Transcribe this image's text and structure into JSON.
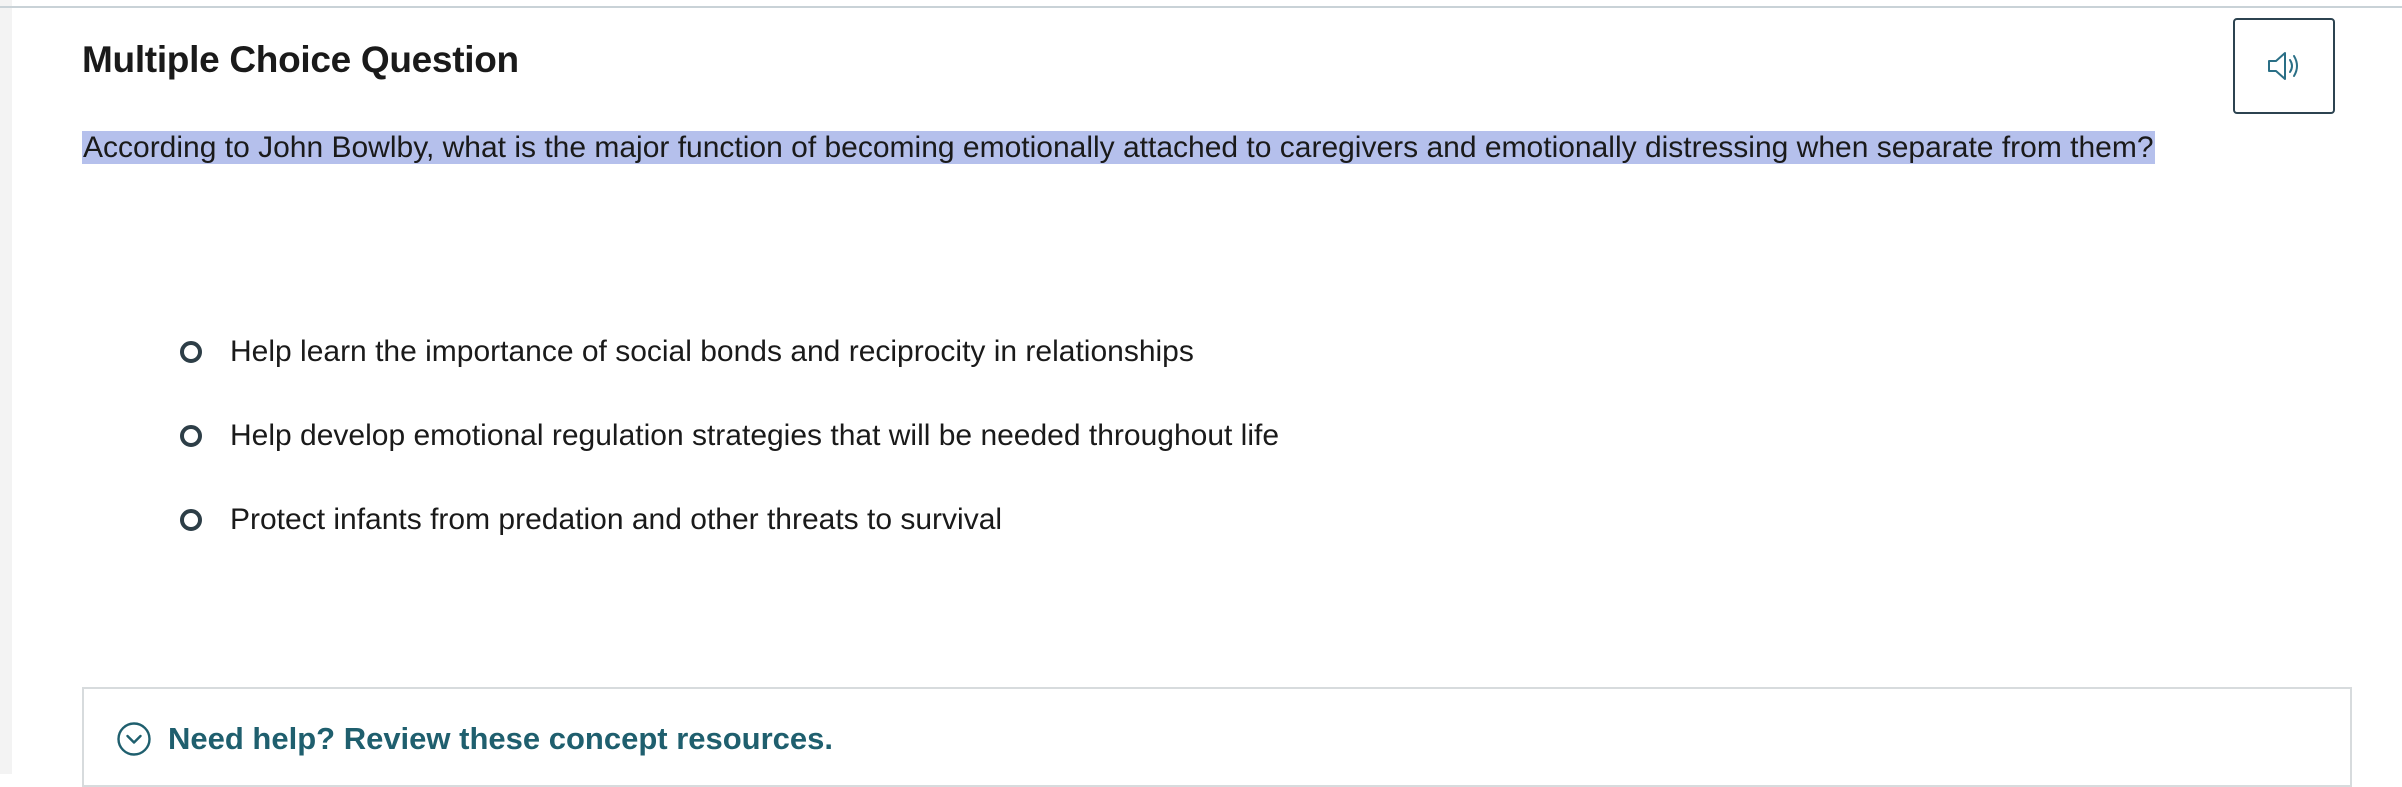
{
  "header": {
    "title": "Multiple Choice Question",
    "audio_icon": "speaker-icon"
  },
  "question": {
    "text": "According to John Bowlby, what is the major function of becoming emotionally attached to caregivers and emotionally distressing when separate from them?"
  },
  "options": [
    {
      "label": "Help learn the importance of social bonds and reciprocity in relationships",
      "selected": false
    },
    {
      "label": "Help develop emotional regulation strategies that will be needed throughout life",
      "selected": false
    },
    {
      "label": "Protect infants from predation and other threats to survival",
      "selected": false
    }
  ],
  "help": {
    "label": "Need help? Review these concept resources.",
    "icon": "chevron-down-circle-icon"
  },
  "colors": {
    "highlight": "#b5c0ec",
    "accent": "#1f5f6e",
    "border": "#2c4350"
  }
}
